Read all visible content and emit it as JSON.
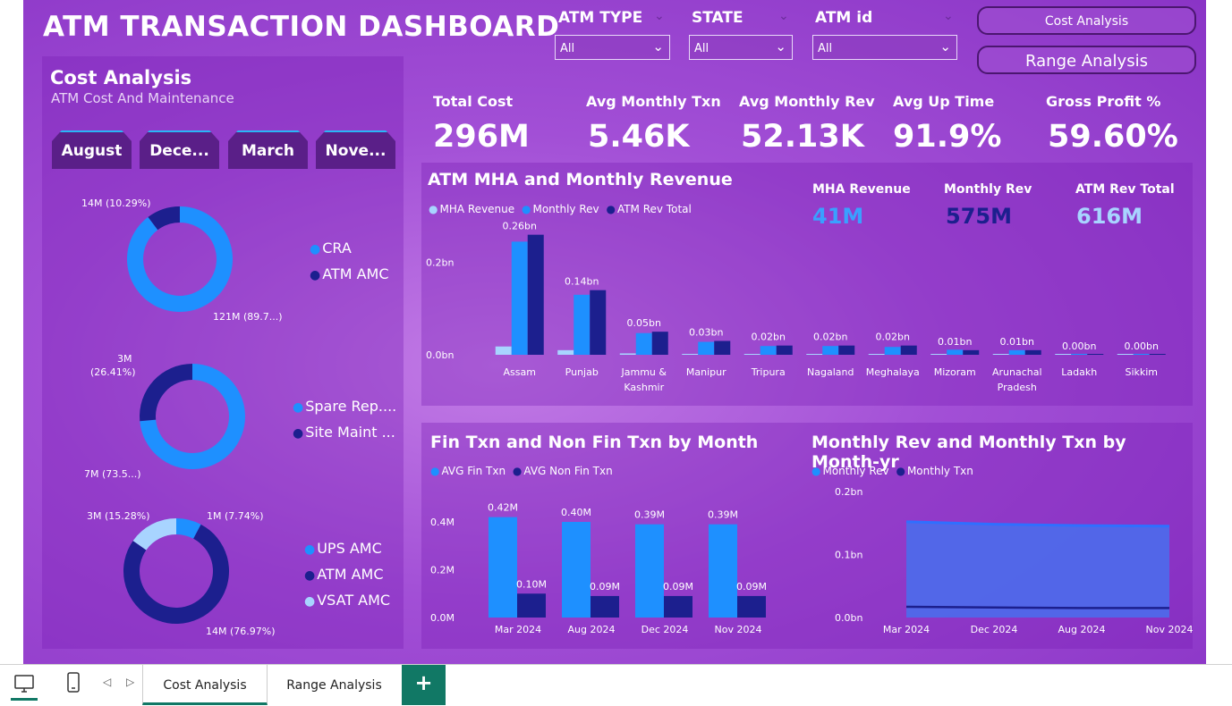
{
  "header": {
    "title": "ATM TRANSACTION DASHBOARD"
  },
  "filters": [
    {
      "label": "ATM TYPE",
      "value": "All"
    },
    {
      "label": "STATE",
      "value": "All"
    },
    {
      "label": "ATM id",
      "value": "All"
    }
  ],
  "nav": {
    "cost_label": "Cost Analysis",
    "range_label": "Range Analysis"
  },
  "cost_panel": {
    "title": "Cost Analysis",
    "subtitle": "ATM Cost And Maintenance",
    "months": [
      "August",
      "Dece...",
      "March",
      "Nove..."
    ],
    "donut1": {
      "labels": [
        "14M (10.29%)",
        "121M (89.7...)"
      ],
      "legend": [
        "CRA",
        "ATM AMC"
      ],
      "slices": [
        {
          "value": 89.71,
          "color": "#1e90ff"
        },
        {
          "value": 10.29,
          "color": "#1c1f8e"
        }
      ]
    },
    "donut2": {
      "labels": [
        "3M",
        "(26.41%)",
        "7M (73.5...)"
      ],
      "legend": [
        "Spare Rep....",
        "Site Maint ..."
      ],
      "slices": [
        {
          "value": 73.59,
          "color": "#1e90ff"
        },
        {
          "value": 26.41,
          "color": "#1c1f8e"
        }
      ]
    },
    "donut3": {
      "labels": [
        "3M (15.28%)",
        "1M (7.74%)",
        "14M (76.97%)"
      ],
      "legend": [
        "UPS AMC",
        "ATM AMC",
        "VSAT AMC"
      ],
      "slices": [
        {
          "value": 7.74,
          "color": "#1e90ff"
        },
        {
          "value": 76.97,
          "color": "#1c1f8e"
        },
        {
          "value": 15.28,
          "color": "#a8d4ff"
        }
      ]
    }
  },
  "kpis": [
    {
      "label": "Total Cost",
      "value": "296M"
    },
    {
      "label": "Avg Monthly Txn",
      "value": "5.46K"
    },
    {
      "label": "Avg Monthly Rev",
      "value": "52.13K"
    },
    {
      "label": "Avg Up Time",
      "value": "91.9%"
    },
    {
      "label": "Gross Profit %",
      "value": "59.60%"
    }
  ],
  "mha_panel": {
    "title": "ATM MHA and Monthly Revenue",
    "legend": [
      "MHA Revenue",
      "Monthly Rev",
      "ATM Rev Total"
    ],
    "cards": [
      {
        "label": "MHA Revenue",
        "value": "41M",
        "color": "#3aa0ff"
      },
      {
        "label": "Monthly Rev",
        "value": "575M",
        "color": "#1c1f8e"
      },
      {
        "label": "ATM Rev Total",
        "value": "616M",
        "color": "#a8d4ff"
      }
    ]
  },
  "fin_panel": {
    "title": "Fin Txn and Non Fin Txn by Month",
    "legend": [
      "AVG Fin Txn",
      "AVG Non Fin Txn"
    ]
  },
  "rev_panel": {
    "title": "Monthly Rev and Monthly Txn by Month-yr",
    "legend": [
      "Monthly Rev",
      "Monthly Txn"
    ]
  },
  "chart_data": [
    {
      "type": "bar",
      "categories": [
        "Assam",
        "Punjab",
        "Jammu & Kashmir",
        "Manipur",
        "Tripura",
        "Nagaland",
        "Meghalaya",
        "Mizoram",
        "Arunachal Pradesh",
        "Ladakh",
        "Sikkim"
      ],
      "series": [
        {
          "name": "MHA Revenue",
          "color": "#a8d4ff",
          "values": [
            0.018,
            0.01,
            0.003,
            0.002,
            0.001,
            0.001,
            0.001,
            0.001,
            0.001,
            0.0,
            0.0
          ]
        },
        {
          "name": "Monthly Rev",
          "color": "#1e90ff",
          "values": [
            0.245,
            0.13,
            0.047,
            0.028,
            0.019,
            0.019,
            0.017,
            0.011,
            0.01,
            0.002,
            0.002
          ]
        },
        {
          "name": "ATM Rev Total",
          "color": "#1c1f8e",
          "values": [
            0.26,
            0.14,
            0.05,
            0.03,
            0.02,
            0.02,
            0.02,
            0.01,
            0.01,
            0.0,
            0.0
          ]
        }
      ],
      "data_labels": [
        "0.26bn",
        "0.14bn",
        "0.05bn",
        "0.03bn",
        "0.02bn",
        "0.02bn",
        "0.02bn",
        "0.01bn",
        "0.01bn",
        "0.00bn",
        "0.00bn"
      ],
      "yticks": [
        "0.0bn",
        "0.2bn"
      ],
      "ylim": [
        0,
        0.3
      ]
    },
    {
      "type": "bar",
      "categories": [
        "Mar 2024",
        "Aug 2024",
        "Dec 2024",
        "Nov 2024"
      ],
      "series": [
        {
          "name": "AVG Fin Txn",
          "color": "#1e90ff",
          "values": [
            0.42,
            0.4,
            0.39,
            0.39
          ],
          "labels": [
            "0.42M",
            "0.40M",
            "0.39M",
            "0.39M"
          ]
        },
        {
          "name": "AVG Non Fin Txn",
          "color": "#1c1f8e",
          "values": [
            0.1,
            0.09,
            0.09,
            0.09
          ],
          "labels": [
            "0.10M",
            "0.09M",
            "0.09M",
            "0.09M"
          ]
        }
      ],
      "yticks": [
        "0.0M",
        "0.2M",
        "0.4M"
      ],
      "ylim": [
        0,
        0.42
      ]
    },
    {
      "type": "area",
      "x": [
        "Mar 2024",
        "Dec 2024",
        "Aug 2024",
        "Nov 2024"
      ],
      "series": [
        {
          "name": "Monthly Rev",
          "color": "#2f6fff",
          "values": [
            0.152,
            0.148,
            0.146,
            0.145
          ]
        },
        {
          "name": "Monthly Txn",
          "color": "#1c1f8e",
          "values": [
            0.017,
            0.016,
            0.015,
            0.015
          ]
        }
      ],
      "yticks": [
        "0.0bn",
        "0.1bn",
        "0.2bn"
      ],
      "ylim": [
        0,
        0.2
      ]
    }
  ],
  "taskbar": {
    "tabs": [
      "Cost Analysis",
      "Range Analysis"
    ],
    "add_label": "+"
  }
}
